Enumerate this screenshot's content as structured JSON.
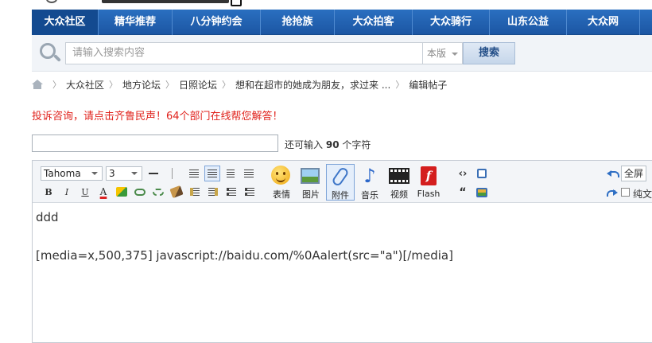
{
  "nav": {
    "items": [
      "大众社区",
      "精华推荐",
      "八分钟约会",
      "抢抢族",
      "大众拍客",
      "大众骑行",
      "山东公益",
      "大众网"
    ]
  },
  "search": {
    "placeholder": "请输入搜索内容",
    "scope": "本版",
    "button": "搜索"
  },
  "breadcrumb": {
    "items": [
      "大众社区",
      "地方论坛",
      "日照论坛",
      "想和在超市的她成为朋友，求过来 ...",
      "编辑帖子"
    ]
  },
  "notice": "投诉咨询，请点击齐鲁民声！64个部门在线帮您解答！",
  "subject": {
    "value": "",
    "hint_prefix": "还可输入",
    "hint_count": "90",
    "hint_suffix": "个字符"
  },
  "toolbar": {
    "font": "Tahoma",
    "size": "3",
    "big": {
      "emoticon": "表情",
      "image": "图片",
      "attachment": "附件",
      "music": "音乐",
      "video": "视频",
      "flash": "Flash"
    },
    "fullscreen": "全屏",
    "plaintext": "纯文"
  },
  "editor": {
    "lines": [
      "ddd",
      "",
      "[media=x,500,375] javascript://baidu.com/%0Aalert(src=\"a\")[/media]"
    ]
  },
  "colors": {
    "nav_bg": "#1c56a3",
    "notice": "#e0221c"
  }
}
